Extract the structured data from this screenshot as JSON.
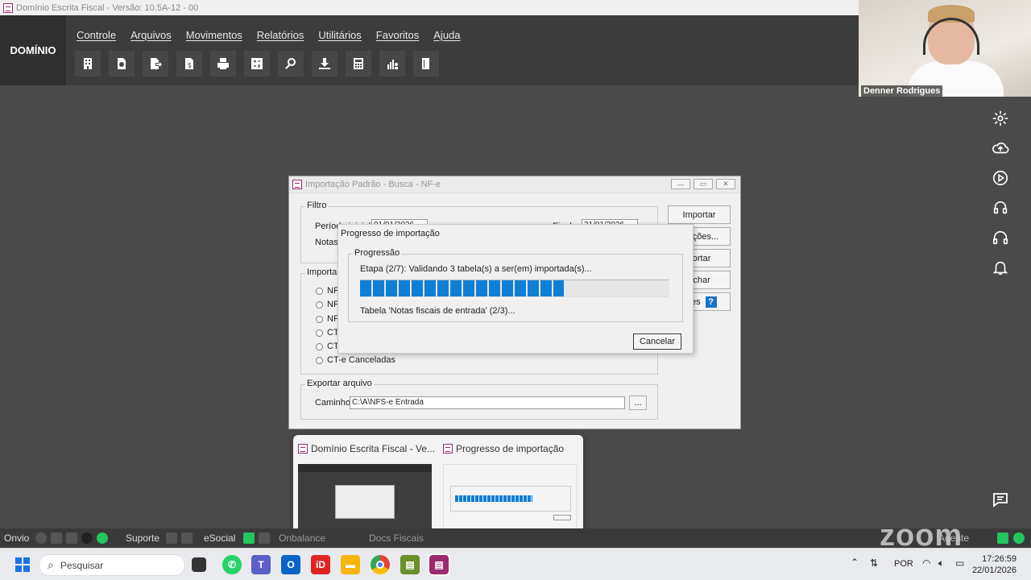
{
  "app": {
    "window_title": "Domínio Escrita Fiscal - Versão: 10.5A-12 - 00",
    "brand": "DOMÍNIO",
    "menu": [
      "Controle",
      "Arquivos",
      "Movimentos",
      "Relatórios",
      "Utilitários",
      "Favoritos",
      "Ajuda"
    ],
    "toolbar_icons": [
      "building-icon",
      "refresh-doc-icon",
      "export-doc-icon",
      "money-doc-icon",
      "printer-icon",
      "calculator-grid-icon",
      "search-icon",
      "download-icon",
      "calculator-icon",
      "chart-person-icon",
      "book-icon"
    ]
  },
  "video": {
    "participant_name": "Denner Rodrigues"
  },
  "side_icons": [
    "gear-icon",
    "cloud-upload-icon",
    "play-icon",
    "headset-agent-icon",
    "headphones-icon",
    "bell-icon"
  ],
  "import_dialog": {
    "title": "Importação Padrão - Busca - NF-e",
    "filtro_label": "Filtro",
    "periodo_inicial_label": "Período inicial:",
    "periodo_inicial_value": "01/01/2026",
    "final_label": "Final:",
    "final_value": "31/01/2026",
    "notas_label": "Notas:",
    "importar_label": "Importar",
    "radios": [
      "NF",
      "NF",
      "NF",
      "CT",
      "CT",
      "CT-e Canceladas"
    ],
    "buttons": [
      "Importar",
      "urações...",
      "portar",
      "echar",
      "ções"
    ],
    "exportar_label": "Exportar arquivo",
    "caminho_label": "Caminho:",
    "caminho_value": "C:\\A\\NFS-e Entrada",
    "browse_label": "..."
  },
  "progress_dialog": {
    "title": "Progresso de importação",
    "group_label": "Progressão",
    "etapa": "Etapa (2/7): Validando 3 tabela(s) a ser(em) importada(s)...",
    "progress_fraction": 0.66,
    "tabela": "Tabela 'Notas fiscais de entrada' (2/3)...",
    "cancel": "Cancelar"
  },
  "taskbar_preview": {
    "items": [
      "Domínio Escrita Fiscal - Ve...",
      "Progresso de importação"
    ]
  },
  "statusbar": {
    "onvio": "Onvio",
    "suporte": "Suporte",
    "esocial": "eSocial",
    "onbalance": "Onbalance",
    "docs": "Docs Fiscais",
    "agente": "Agente",
    "zoom": "zoom"
  },
  "taskbar": {
    "search_placeholder": "Pesquisar",
    "language": "POR",
    "time": "17:26:59",
    "date": "22/01/2026"
  },
  "colors": {
    "progress": "#0f7fd6",
    "status_green": "#22c55e",
    "brand_magenta": "#9b2a6f"
  }
}
